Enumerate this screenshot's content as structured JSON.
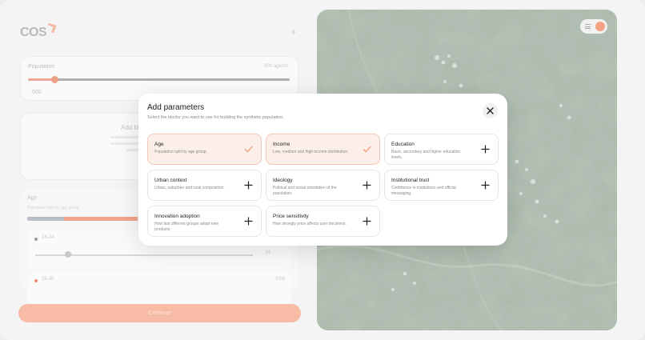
{
  "app": {
    "logo_text": "COS",
    "population": {
      "label": "Population",
      "count": "500 agents",
      "value": "500",
      "fraction": 0.1
    },
    "add_block": {
      "title": "Add bl"
    },
    "age": {
      "label": "Age",
      "subtitle": "Population split by age group",
      "rows": [
        {
          "name": "18-24",
          "value": "14",
          "color": "#b3b3b3"
        },
        {
          "name": "25-35",
          "value": "31%",
          "color": "#f2a58d"
        }
      ]
    },
    "continue_label": "Continue"
  },
  "colors": {
    "accent": "#f3a283",
    "selected_bg": "#fcefe9"
  },
  "modal": {
    "title": "Add parameters",
    "subtitle": "Select the blocks you want to use for building the synthetic population.",
    "close_icon": "close-icon",
    "options": [
      {
        "title": "Age",
        "description": "Population split by age group.",
        "selected": true
      },
      {
        "title": "Income",
        "description": "Low, medium and high income distribution.",
        "selected": true
      },
      {
        "title": "Education",
        "description": "Basic, secondary and higher education levels.",
        "selected": false
      },
      {
        "title": "Urban context",
        "description": "Urban, suburban and rural composition.",
        "selected": false
      },
      {
        "title": "Ideology",
        "description": "Political and social orientation of the population.",
        "selected": false
      },
      {
        "title": "Institutional trust",
        "description": "Confidence in institutions and official messaging.",
        "selected": false
      },
      {
        "title": "Innovation adoption",
        "description": "How fast different groups adopt new products.",
        "selected": false
      },
      {
        "title": "Price sensitivity",
        "description": "How strongly price affects user decisions.",
        "selected": false
      }
    ]
  }
}
